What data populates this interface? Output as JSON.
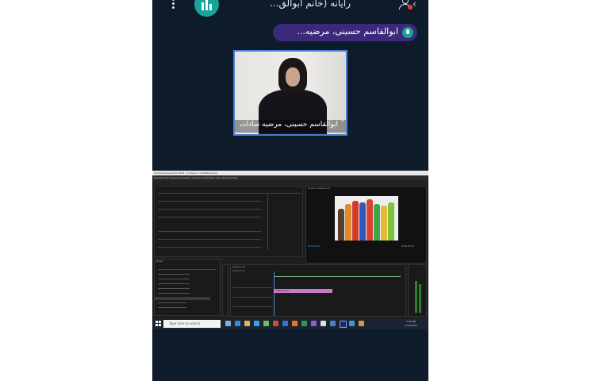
{
  "meeting": {
    "title": "رایانه (خانم ابوالق...",
    "speaker_pill": "ابوالقاسم حسینی، مرضیه...",
    "tile_caption": "ابوالقاسم حسینی، مرضیه سادات",
    "accent_color": "#1aa39b",
    "pill_color": "#3b2a7a",
    "tile_border_color": "#4a7fd4",
    "icons": [
      "more-vertical-icon",
      "participants-bars-icon",
      "user-icon",
      "chevron-icon",
      "mic-icon",
      "caret-up-icon"
    ]
  },
  "shared_screen": {
    "window_title": "Adobe Premiere Pro 2022 - C:\\Users\\...\\Untitled.prproj",
    "menu": "File  Edit  Clip  Sequence  Markers  Graphics and Titles  View  Window  Help",
    "project_panel": "Project",
    "program_panel": "Program: sequence 01",
    "timecode_left": "00:00:00:00",
    "timecode_right": "00:00:04:29",
    "timeline_tab": "sequence 01",
    "timeline_timecode": "00:00:00:00",
    "clip_label": "sequence 01",
    "taskbar_search": "Type here to search",
    "clock_time": "1:02 PM",
    "clock_date": "2/11/2022"
  }
}
